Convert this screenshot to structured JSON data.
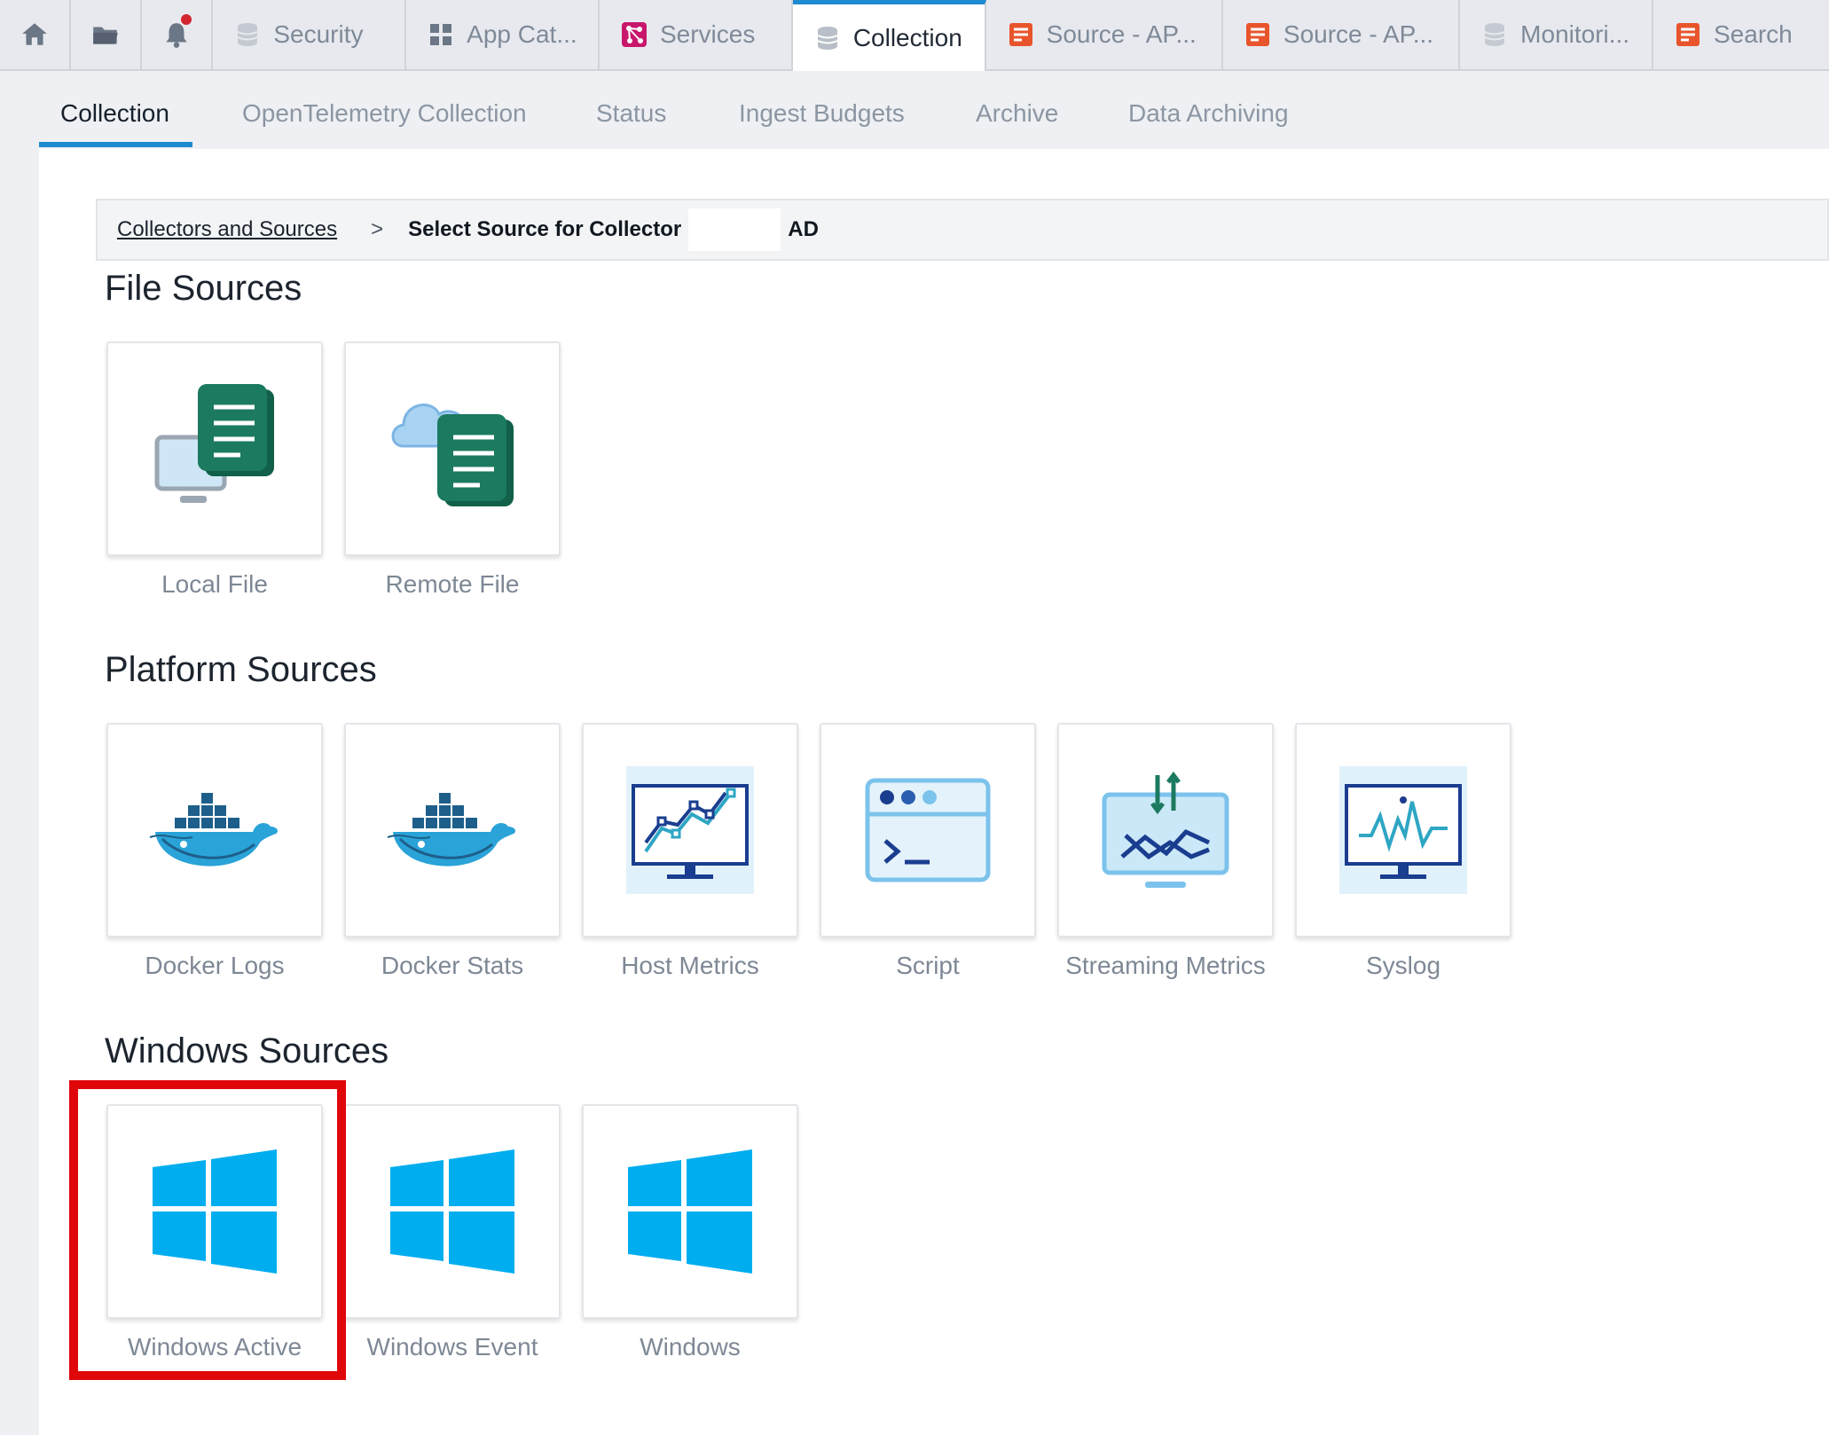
{
  "topbar": {
    "icon_tabs": [
      {
        "icon": "home-icon"
      },
      {
        "icon": "folder-icon"
      },
      {
        "icon": "bell-icon"
      }
    ],
    "tabs": [
      {
        "label": "Security",
        "icon": "database-icon"
      },
      {
        "label": "App Cat...",
        "icon": "grid-icon"
      },
      {
        "label": "Services",
        "icon": "services-icon"
      },
      {
        "label": "Collection",
        "icon": "database-icon",
        "active": true
      },
      {
        "label": "Source - AP...",
        "icon": "document-icon"
      },
      {
        "label": "Source - AP...",
        "icon": "document-icon"
      },
      {
        "label": "Monitori...",
        "icon": "database-icon"
      },
      {
        "label": "Search",
        "icon": "document-icon"
      }
    ]
  },
  "subnav": {
    "items": [
      "Collection",
      "OpenTelemetry Collection",
      "Status",
      "Ingest Budgets",
      "Archive",
      "Data Archiving"
    ],
    "active": "Collection"
  },
  "breadcrumb": {
    "link": "Collectors and Sources",
    "separator": ">",
    "current": "Select Source for Collector",
    "suffix": "AD"
  },
  "sections": {
    "file": {
      "title": "File Sources",
      "items": [
        {
          "label": "Local File",
          "icon": "local-file-icon"
        },
        {
          "label": "Remote File",
          "icon": "remote-file-icon"
        }
      ]
    },
    "platform": {
      "title": "Platform Sources",
      "items": [
        {
          "label": "Docker Logs",
          "icon": "docker-icon"
        },
        {
          "label": "Docker Stats",
          "icon": "docker-icon"
        },
        {
          "label": "Host Metrics",
          "icon": "host-metrics-icon"
        },
        {
          "label": "Script",
          "icon": "script-icon"
        },
        {
          "label": "Streaming Metrics",
          "icon": "streaming-metrics-icon"
        },
        {
          "label": "Syslog",
          "icon": "syslog-icon"
        }
      ]
    },
    "windows": {
      "title": "Windows Sources",
      "items": [
        {
          "label": "Windows Active",
          "icon": "windows-logo-icon",
          "highlighted": true
        },
        {
          "label": "Windows Event",
          "icon": "windows-logo-icon"
        },
        {
          "label": "Windows",
          "icon": "windows-logo-icon"
        }
      ]
    }
  },
  "colors": {
    "accent": "#1e8bd0",
    "highlight": "#e0070b",
    "windows_blue": "#00adef",
    "file_green": "#1b7a5f"
  }
}
